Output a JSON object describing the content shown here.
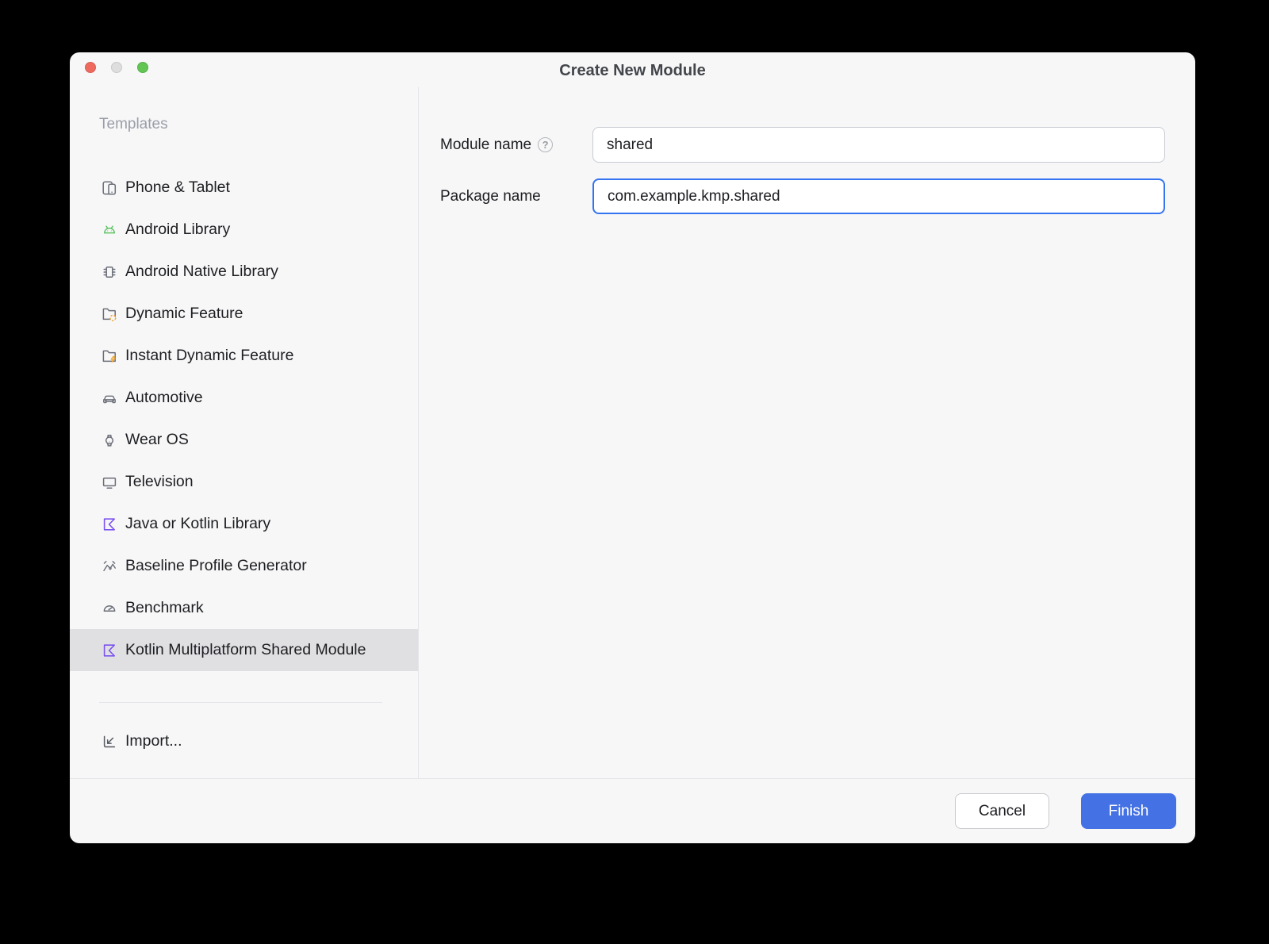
{
  "window": {
    "title": "Create New Module"
  },
  "sidebar": {
    "header": "Templates",
    "items": [
      {
        "label": "Phone & Tablet",
        "icon": "phone-tablet-icon",
        "selected": false
      },
      {
        "label": "Android Library",
        "icon": "android-head-icon",
        "selected": false
      },
      {
        "label": "Android Native Library",
        "icon": "chip-icon",
        "selected": false
      },
      {
        "label": "Dynamic Feature",
        "icon": "folder-dynamic-icon",
        "selected": false
      },
      {
        "label": "Instant Dynamic Feature",
        "icon": "folder-lightning-icon",
        "selected": false
      },
      {
        "label": "Automotive",
        "icon": "car-icon",
        "selected": false
      },
      {
        "label": "Wear OS",
        "icon": "watch-icon",
        "selected": false
      },
      {
        "label": "Television",
        "icon": "tv-icon",
        "selected": false
      },
      {
        "label": "Java or Kotlin Library",
        "icon": "kotlin-icon",
        "selected": false
      },
      {
        "label": "Baseline Profile Generator",
        "icon": "profile-chart-icon",
        "selected": false
      },
      {
        "label": "Benchmark",
        "icon": "gauge-icon",
        "selected": false
      },
      {
        "label": "Kotlin Multiplatform Shared Module",
        "icon": "kotlin-icon",
        "selected": true
      }
    ],
    "import_label": "Import..."
  },
  "form": {
    "module_name": {
      "label": "Module name",
      "value": "shared",
      "help": "?"
    },
    "package_name": {
      "label": "Package name",
      "value": "com.example.kmp.shared"
    }
  },
  "footer": {
    "cancel_label": "Cancel",
    "finish_label": "Finish"
  },
  "colors": {
    "window_background": "#F7F7F8",
    "selected_row_gray": "#E0E0E3",
    "focus_border_blue": "#3574F0",
    "finish_button_blue": "#4471E3",
    "kotlin_purple": "#7B52F0",
    "android_green": "#5FC463",
    "feature_orange": "#F0A732",
    "traffic_red": "#EE6A5F",
    "traffic_gray": "#DEDEDE",
    "traffic_green": "#62C554"
  }
}
